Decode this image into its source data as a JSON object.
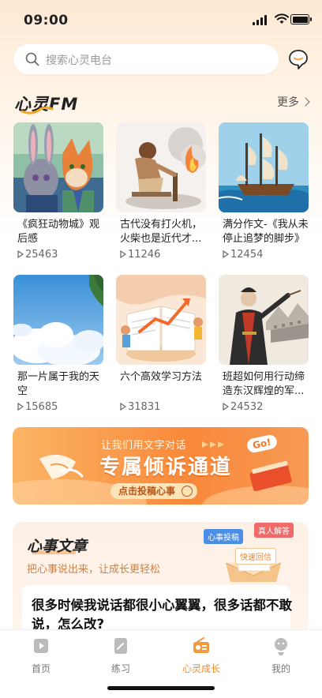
{
  "status": {
    "time": "09:00"
  },
  "search": {
    "placeholder": "搜索心灵电台"
  },
  "fm": {
    "title": "心灵FM",
    "more_label": "更多",
    "items": [
      {
        "title": "《疯狂动物城》观后感",
        "plays": "25463"
      },
      {
        "title": "古代没有打火机，火柴也是近代才...",
        "plays": "11246"
      },
      {
        "title": "满分作文-《我从未停止追梦的脚步》",
        "plays": "12454"
      },
      {
        "title": "那一片属于我的天空",
        "plays": "15685"
      },
      {
        "title": "六个高效学习方法",
        "plays": "31831"
      },
      {
        "title": "班超如何用行动缔造东汉辉煌的军...",
        "plays": "24532"
      }
    ]
  },
  "banner": {
    "small_text": "让我们用文字对话",
    "big_text": "专属倾诉通道",
    "cta_label": "点击投稿心事",
    "go_badge": "Go!"
  },
  "article": {
    "title": "心事文章",
    "subtitle": "把心事说出来，让成长更轻松",
    "tags": [
      "心事投稿",
      "真人解答",
      "快速回信"
    ],
    "question": "很多时候我说话都很小心翼翼，很多话都不敢说，怎么改?"
  },
  "tabs": [
    {
      "label": "首页",
      "icon": "home-icon"
    },
    {
      "label": "练习",
      "icon": "practice-icon"
    },
    {
      "label": "心灵成长",
      "icon": "radio-icon"
    },
    {
      "label": "我的",
      "icon": "profile-icon"
    }
  ],
  "colors": {
    "accent": "#f08a2c",
    "banner": "#f9893a"
  }
}
